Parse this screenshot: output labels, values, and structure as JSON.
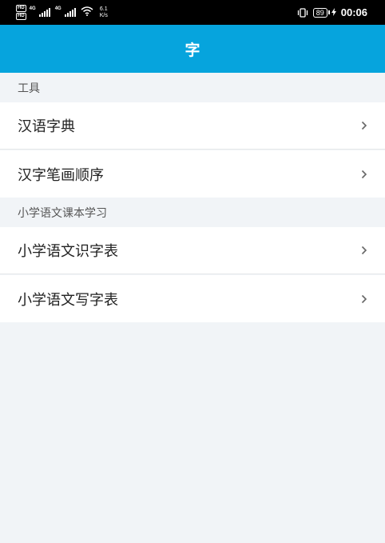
{
  "status_bar": {
    "hd1": "HD",
    "hd2": "HD",
    "net1": "4G",
    "net2": "4G",
    "speed_value": "6.1",
    "speed_unit": "K/s",
    "battery": "89",
    "time": "00:06"
  },
  "app_bar": {
    "title": "字"
  },
  "sections": [
    {
      "header": "工具",
      "items": [
        {
          "label": "汉语字典"
        },
        {
          "label": "汉字笔画顺序"
        }
      ]
    },
    {
      "header": "小学语文课本学习",
      "items": [
        {
          "label": "小学语文识字表"
        },
        {
          "label": "小学语文写字表"
        }
      ]
    }
  ],
  "icons": {
    "chevron": "chevron-right-icon",
    "wifi": "wifi-icon",
    "vibrate": "vibrate-icon",
    "charging": "charging-icon"
  },
  "colors": {
    "accent": "#06a4dd",
    "background": "#f1f4f7",
    "item_background": "#ffffff",
    "text": "#222222",
    "chevron": "#666666"
  }
}
